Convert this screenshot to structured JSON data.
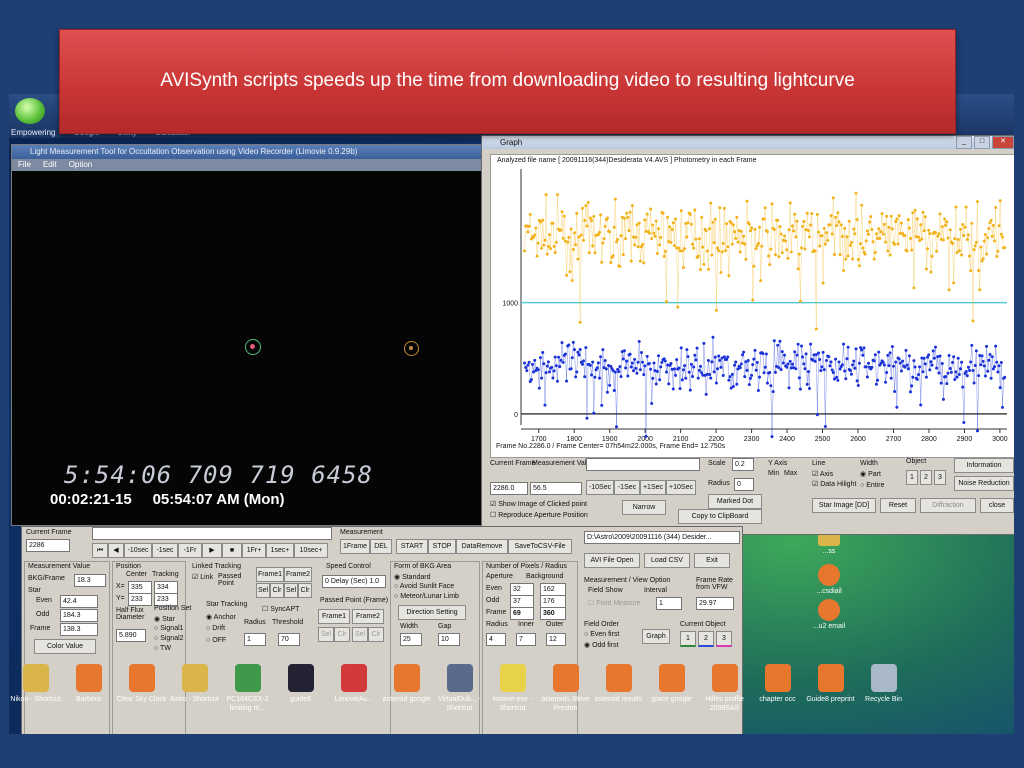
{
  "banner": {
    "text": "AVISynth scripts speeds up the time from downloading video to resulting lightcurve"
  },
  "desktop_top": {
    "icons": [
      "Empowering",
      "Google",
      "Utility",
      "Calculator"
    ]
  },
  "main_window": {
    "title": "Light Measurement Tool for Occultation Observation using Video Recorder (Limovie 0.9.29b)",
    "menu": [
      "File",
      "Edit",
      "Option"
    ],
    "osd_line1": "5:54:06  709  719    6458",
    "osd_line2_time": "00:02:21-15",
    "osd_line2_clock": "05:54:07 AM  (Mon)"
  },
  "graph_window": {
    "title": "Graph",
    "plot_header": "Analyzed file name [ 20091116(344)Desiderata V4.AVS ]   Photometry in each Frame",
    "y_labels": [
      "1000",
      "0"
    ],
    "x_labels": [
      "1700",
      "1800",
      "1900",
      "2000",
      "2100",
      "2200",
      "2300",
      "2400",
      "2500",
      "2600",
      "2700",
      "2800",
      "2900",
      "3000"
    ],
    "frame_info": "Frame No.2286.0 / Frame Center= 07h54m22.000s,  Frame End= 12.750s",
    "current_frame_label": "Current Frame",
    "current_frame_value": "2286.0",
    "measurement_label": "Measurement Value",
    "measurement_value": "56.5",
    "nav_buttons": [
      "-10Sec",
      "-1Sec",
      "+1Sec",
      "+10Sec"
    ],
    "scale_label": "Scale",
    "scale_value": "0.2",
    "radius_label": "Radius",
    "radius_value": "0",
    "marked_dot": "Marked Dot",
    "narrow": "Narrow",
    "copy_clip": "Copy to ClipBoard",
    "show_image": "Show Image of Clicked point",
    "reproduce": "Reproduce Aperture Position",
    "yaxis_label": "Y Axis",
    "min_max": [
      "Min",
      "Max"
    ],
    "line_label": "Line",
    "line_opts": [
      "Axis",
      "Data Hilight"
    ],
    "width_label": "Width",
    "width_opts": [
      "Part",
      "Entire"
    ],
    "object_label": "Object",
    "objects": [
      "1",
      "2",
      "3"
    ],
    "information": "Information",
    "noise_reduction": "Noise Reduction",
    "star_image": "Star Image [DD]",
    "reset": "Reset",
    "diffraction": "Diffraction",
    "close": "close"
  },
  "panel": {
    "current_frame_label": "Current Frame",
    "current_frame_value": "2286",
    "transport": [
      "⏮",
      "◀",
      "-10sec",
      "-1sec",
      "-1Fr",
      "▶",
      "■",
      "1Fr+",
      "1sec+",
      "10sec+"
    ],
    "measurement_label": "Measurement",
    "meas_buttons": [
      "1Frame",
      "DEL",
      "START",
      "STOP",
      "DataRemove",
      "SaveToCSV-File"
    ],
    "meas_value_label": "Measurement Value",
    "bkg_frame": "BKG/Frame",
    "bkg_value": "18.3",
    "star_label": "Star",
    "even_label": "Even",
    "even_value": "42.4",
    "odd_label": "Odd",
    "odd_value": "184.3",
    "frame_label": "Frame",
    "frame_value": "138.3",
    "color_value": "Color Value",
    "position_label": "Position",
    "center_label": "Center",
    "tracking_label": "Tracking",
    "x_label": "X=",
    "x_center": "335",
    "x_track": "334",
    "y_label": "Y=",
    "y_center": "233",
    "y_track": "233",
    "half_flux": "Half Flux Diameter",
    "half_flux_value": "5.890",
    "linked_tracking": "Linked Tracking",
    "link": "Link",
    "passed_point": "Passed Point",
    "frame1": "Frame1",
    "frame2": "Frame2",
    "sel": "Sel",
    "clr": "Clr",
    "position_set": "Position Set",
    "star_opt": "Star",
    "signal1": "Signal1",
    "signal2": "Signal2",
    "tw": "TW",
    "star_tracking": "Star Tracking",
    "anchor": "Anchor",
    "drift": "Drift",
    "off": "OFF",
    "radius": "Radius",
    "threshold": "Threshold",
    "radius_val": "1",
    "threshold_val": "70",
    "sync_apt": "SyncAPT",
    "speed_control": "Speed Control",
    "delay": "0  Delay (Sec) 1.0",
    "passed_point_frame": "Passed Point (Frame)",
    "bkg_area_label": "Form of BKG Area",
    "standard": "Standard",
    "avoid_sunlit": "Avoid Sunlit Face",
    "meteor_limb": "Meteor/Lunar Limb",
    "direction_setting": "Direction Setting",
    "width_label": "Width",
    "gap_label": "Gap",
    "width_val": "25",
    "gap_val": "10",
    "pixels_label": "Number of Pixels / Radius",
    "aperture": "Aperture",
    "background": "Background",
    "ap_even": "32",
    "bg_even": "162",
    "ap_odd": "37",
    "bg_odd": "176",
    "ap_frame": "69",
    "bg_frame": "360",
    "radius2": "Radius",
    "inner": "Inner",
    "outer": "Outer",
    "r_val": "4",
    "i_val": "7",
    "o_val": "12",
    "file_path": "D:\\Astro\\2009\\20091116 (344) Desider...",
    "avi_open": "AVI File Open",
    "load_csv": "Load CSV",
    "exit": "Exit",
    "meas_view": "Measurement / View Option",
    "field_show": "Field Show",
    "interval": "Interval",
    "interval_val": "1",
    "field_measure": "Field Measure",
    "frame_rate": "Frame Rate from VFW",
    "frame_rate_val": "29.97",
    "field_order": "Field Order",
    "even_first": "Even first",
    "odd_first": "Odd first",
    "graph_btn": "Graph",
    "current_object": "Current Object",
    "objects": [
      "1",
      "2",
      "3"
    ]
  },
  "desktop_icons": [
    {
      "label": "Nikon - Shortcut",
      "color": "#d9b54a"
    },
    {
      "label": "Barbera",
      "color": "#e8772e"
    },
    {
      "label": "Clear Sky Clock",
      "color": "#e8772e"
    },
    {
      "label": "Astro - Shortcut",
      "color": "#d9b54a"
    },
    {
      "label": "PC164CEX-2 limiting m...",
      "color": "#3e9a4a"
    },
    {
      "label": "guide8",
      "color": "#222233"
    },
    {
      "label": "LimovieAv...",
      "color": "#d23a3a"
    },
    {
      "label": "asteroid google",
      "color": "#e8772e"
    },
    {
      "label": "VirtualDub... - Shortcut",
      "color": "#5a6a8a"
    },
    {
      "label": "limovie.exe - Shortcut",
      "color": "#e8d24a"
    },
    {
      "label": "asteroids Steve Preston",
      "color": "#e8772e"
    },
    {
      "label": "asteroid results",
      "color": "#e8772e"
    },
    {
      "label": "grace google",
      "color": "#e8772e"
    },
    {
      "label": "Hilfes profile 2009SAS",
      "color": "#e8772e"
    },
    {
      "label": "chapter occ",
      "color": "#e8772e"
    },
    {
      "label": "Guide8 preprint",
      "color": "#e8772e"
    },
    {
      "label": "Recycle Bin",
      "color": "#a8b8c8"
    }
  ],
  "side_icons": [
    "...ss",
    "...csdiail",
    "...u2 email"
  ],
  "chart_data": {
    "type": "scatter",
    "title": "Analyzed file name [ 20091116(344)Desiderata V4.AVS ]   Photometry in each Frame",
    "xlabel": "",
    "ylabel": "",
    "xlim": [
      1650,
      3020
    ],
    "ylim": [
      -100,
      2200
    ],
    "grid": false,
    "series": [
      {
        "color": "#f2b21a",
        "mean": 1600,
        "spread": 300
      },
      {
        "color": "#1a32d8",
        "mean": 430,
        "spread": 230
      }
    ],
    "reference_lines": [
      {
        "y": 1000,
        "color": "#55cbd6"
      },
      {
        "y": 0,
        "color": "#444444"
      }
    ]
  }
}
